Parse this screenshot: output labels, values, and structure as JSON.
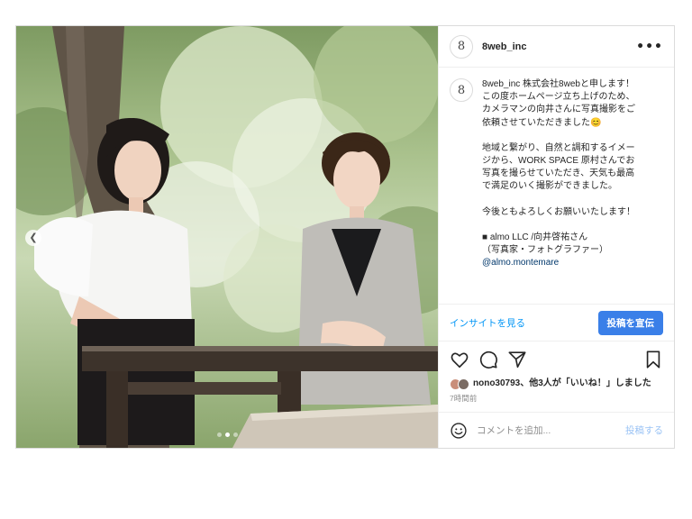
{
  "post": {
    "username": "8web_inc",
    "avatar_glyph": "8",
    "more_label": "•••",
    "caption": {
      "username": "8web_inc",
      "line1": " 株式会社8webと申します！",
      "line2": "この度ホームページ立ち上げのため、",
      "line3": "カメラマンの向井さんに写真撮影をご",
      "line4": "依頼させていただきました😊",
      "line5": "地域と繋がり、自然と調和するイメー",
      "line6": "ジから、WORK SPACE 原村さんでお",
      "line7": "写真を撮らせていただき、天気も最高",
      "line8": "で満足のいく撮影ができました。",
      "line9": "今後ともよろしくお願いいたします！",
      "line10": "■ almo LLC /向井啓祐さん",
      "line11": "（写真家・フォトグラファー）",
      "mention": "@almo.montemare"
    },
    "insight_link": "インサイトを見る",
    "promote_button": "投稿を宣伝",
    "likes_text": "nono30793、他3人が「いいね！」しました",
    "timestamp": "7時間前",
    "comment_placeholder": "コメントを追加...",
    "post_button": "投稿する"
  },
  "icons": {
    "like": "heart-icon",
    "comment": "comment-icon",
    "share": "paper-plane-icon",
    "save": "bookmark-icon",
    "emoji": "smiley-icon",
    "carousel_prev": "chevron-left-icon"
  },
  "carousel": {
    "slides": 3,
    "active_slide": 2
  },
  "colors": {
    "link_blue": "#0095f6",
    "promote_blue": "#3a7fe8",
    "post_button_disabled": "#9ac3f5",
    "mention_blue": "#00376b",
    "muted": "#8e8e8e",
    "border": "#dbdbdb"
  }
}
